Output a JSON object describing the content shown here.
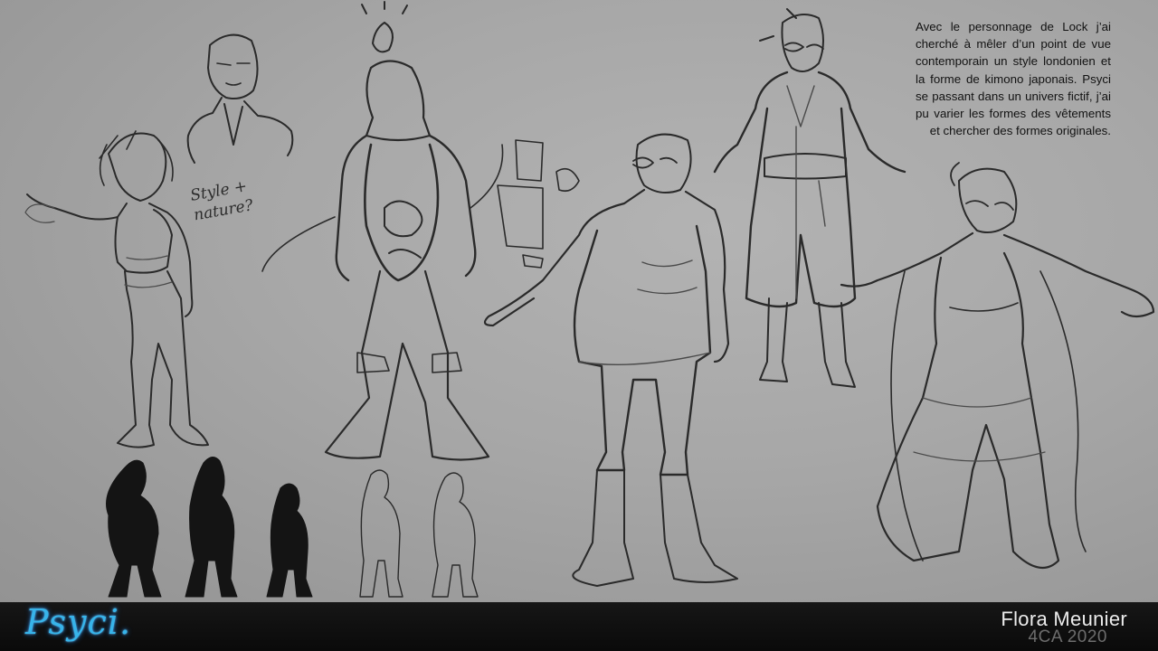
{
  "description": {
    "text": "Avec le personnage de Lock j’ai cherché à mêler d’un point de vue contemporain un style londonien et la forme de kimono japonais. Psyci se passant dans un univers fictif, j’ai pu varier les formes des vêtements et chercher des formes originales."
  },
  "sketch_note": {
    "text": "Style +\nnature?"
  },
  "footer": {
    "logo": "Psyci.",
    "author": "Flora Meunier",
    "class": "4CA 2020"
  },
  "colors": {
    "background": "#a9a9a9",
    "footer": "#111111",
    "logo": "#37b4ea",
    "author": "#ececec",
    "class": "#6d6d6d"
  }
}
